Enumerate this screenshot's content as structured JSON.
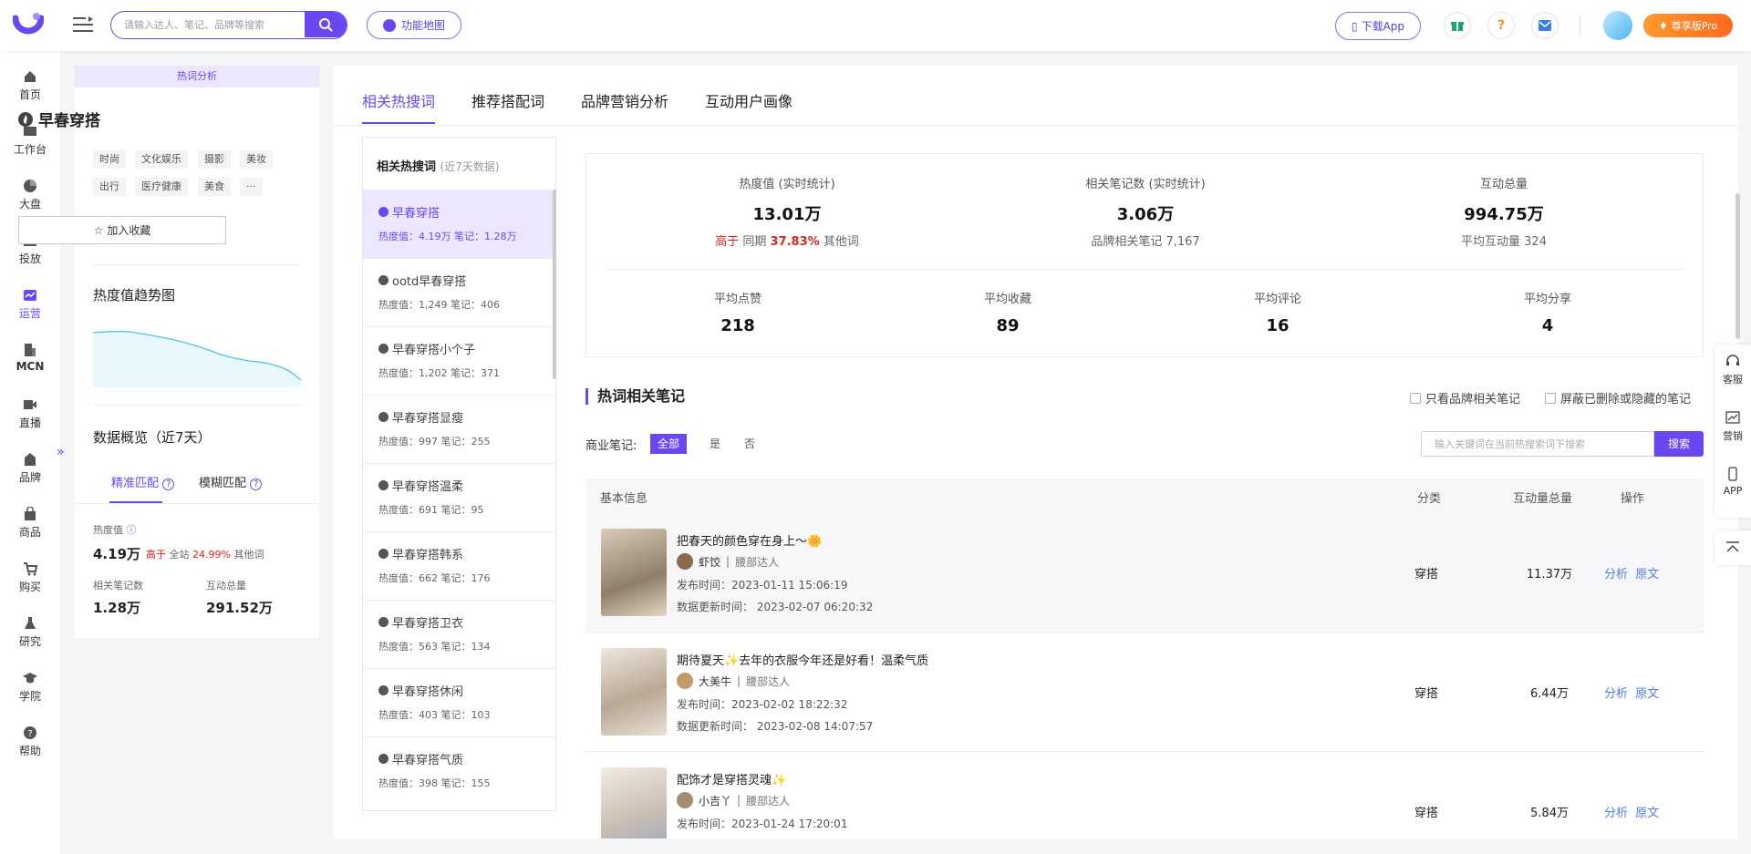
{
  "header": {
    "search_placeholder": "请输入达人、笔记、品牌等搜索",
    "feature_map": "功能地图",
    "download_app": "下载App",
    "pro_label": "尊享版Pro"
  },
  "sidebar": {
    "items": [
      {
        "label": "首页",
        "icon": "home-icon"
      },
      {
        "label": "工作台",
        "icon": "workbench-icon"
      },
      {
        "label": "大盘",
        "icon": "pie-chart-icon"
      },
      {
        "label": "投放",
        "icon": "folder-icon"
      },
      {
        "label": "运营",
        "icon": "trend-icon"
      },
      {
        "label": "MCN",
        "icon": "building-icon"
      },
      {
        "label": "直播",
        "icon": "video-icon"
      },
      {
        "label": "品牌",
        "icon": "store-icon"
      },
      {
        "label": "商品",
        "icon": "bag-icon"
      },
      {
        "label": "购买",
        "icon": "cart-icon"
      },
      {
        "label": "研究",
        "icon": "flask-icon"
      },
      {
        "label": "学院",
        "icon": "graduation-icon"
      },
      {
        "label": "帮助",
        "icon": "help-icon"
      }
    ]
  },
  "left_card": {
    "header": "热词分析",
    "keyword": "早春穿搭",
    "tags": [
      "时尚",
      "文化娱乐",
      "摄影",
      "美妆",
      "出行",
      "医疗健康",
      "美食",
      "···"
    ],
    "favorite_label": "加入收藏",
    "trend_title": "热度值趋势图",
    "overview_title": "数据概览（近7天）",
    "match_tabs": [
      "精准匹配",
      "模糊匹配"
    ],
    "heat_label": "热度值",
    "heat_value": "4.19万",
    "heat_higher": "高于",
    "heat_scope": "全站",
    "heat_pct": "24.99%",
    "heat_other": "其他词",
    "notes_label": "相关笔记数",
    "notes_value": "1.28万",
    "interact_label": "互动总量",
    "interact_value": "291.52万"
  },
  "tabs": [
    "相关热搜词",
    "推荐搭配词",
    "品牌营销分析",
    "互动用户画像"
  ],
  "hot_list": {
    "title": "相关热搜词",
    "subtitle": "(近7天数据)",
    "items": [
      {
        "name": "早春穿搭",
        "stats": "热度值：4.19万  笔记：1.28万"
      },
      {
        "name": "ootd早春穿搭",
        "stats": "热度值：1,249    笔记：406"
      },
      {
        "name": "早春穿搭小个子",
        "stats": "热度值：1,202    笔记：371"
      },
      {
        "name": "早春穿搭显瘦",
        "stats": "热度值：997      笔记：255"
      },
      {
        "name": "早春穿搭温柔",
        "stats": "热度值：691      笔记：95"
      },
      {
        "name": "早春穿搭韩系",
        "stats": "热度值：662      笔记：176"
      },
      {
        "name": "早春穿搭卫衣",
        "stats": "热度值：563      笔记：134"
      },
      {
        "name": "早春穿搭休闲",
        "stats": "热度值：403      笔记：103"
      },
      {
        "name": "早春穿搭气质",
        "stats": "热度值：398      笔记：155"
      }
    ]
  },
  "overview": {
    "heat_label": "热度值 (实时统计)",
    "heat_value": "13.01万",
    "higher": "高于",
    "same_period": "同期",
    "pct": "37.83%",
    "other": "其他词",
    "notes_label": "相关笔记数 (实时统计)",
    "notes_value": "3.06万",
    "brand_notes": "品牌相关笔记 7,167",
    "interact_label": "互动总量",
    "interact_value": "994.75万",
    "avg_interact": "平均互动量 324",
    "avg": [
      {
        "label": "平均点赞",
        "value": "218"
      },
      {
        "label": "平均收藏",
        "value": "89"
      },
      {
        "label": "平均评论",
        "value": "16"
      },
      {
        "label": "平均分享",
        "value": "4"
      }
    ]
  },
  "notes": {
    "title": "热词相关笔记",
    "only_brand": "只看品牌相关笔记",
    "hide_deleted": "屏蔽已删除或隐藏的笔记",
    "commercial_label": "商业笔记:",
    "filters": [
      "全部",
      "是",
      "否"
    ],
    "search_placeholder": "输入关键词在当前热搜索词下搜索",
    "search_btn": "搜索",
    "columns": [
      "基本信息",
      "分类",
      "互动量总量",
      "操作"
    ],
    "rows": [
      {
        "title": "把春天的颜色穿在身上～🌼",
        "author": "虾饺",
        "level": "腰部达人",
        "publish": "发布时间：2023-01-11 15:06:19",
        "update": "数据更新时间：  2023-02-07 06:20:32",
        "category": "穿搭",
        "interact": "11.37万",
        "thumb_color": "#c9b8a4"
      },
      {
        "title": "期待夏天✨去年的衣服今年还是好看！温柔气质",
        "author": "大美牛",
        "level": "腰部达人",
        "publish": "发布时间：2023-02-02 18:22:32",
        "update": "数据更新时间：  2023-02-08 14:07:57",
        "category": "穿搭",
        "interact": "6.44万",
        "thumb_color": "#d8cfc4"
      },
      {
        "title": "配饰才是穿搭灵魂✨",
        "author": "小吉丫",
        "level": "腰部达人",
        "publish": "发布时间：2023-01-24 17:20:01",
        "update": "",
        "category": "穿搭",
        "interact": "5.84万",
        "thumb_color": "#e0d8d0"
      }
    ],
    "op_analyze": "分析",
    "op_original": "原文"
  },
  "right_float": {
    "items": [
      "客服",
      "营销",
      "APP"
    ]
  },
  "colors": {
    "accent": "#6b47f0",
    "red": "#e1251b",
    "link": "#4a7ef0"
  }
}
